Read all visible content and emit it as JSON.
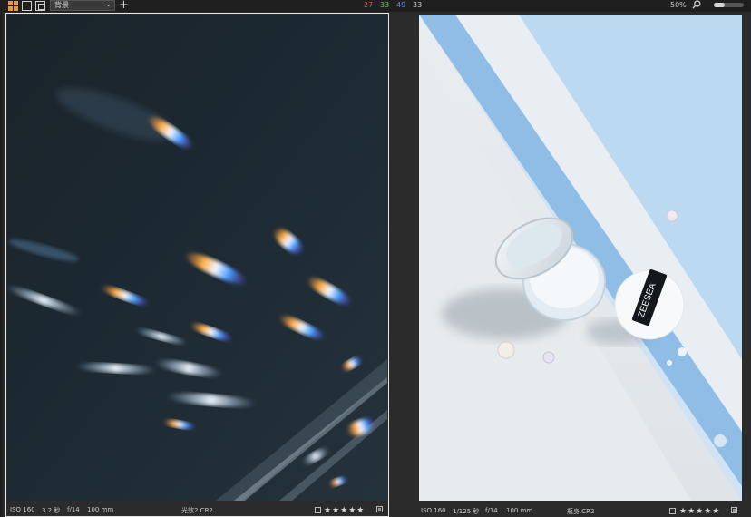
{
  "toolbar": {
    "variant_label": "背景",
    "counts": [
      {
        "value": "27",
        "color": "#e0505a"
      },
      {
        "value": "33",
        "color": "#6ccf5a"
      },
      {
        "value": "49",
        "color": "#6f86e6"
      },
      {
        "value": "33",
        "color": "#cfcfcf"
      }
    ],
    "zoom_label": "50%",
    "zoom_fraction": 0.35
  },
  "viewers": [
    {
      "iso": "ISO 160",
      "shutter": "3.2 秒",
      "aperture": "f/14",
      "focal": "100 mm",
      "filename": "光效2.CR2",
      "rating": "★★★★★",
      "selected": true
    },
    {
      "iso": "ISO 160",
      "shutter": "1/125 秒",
      "aperture": "f/14",
      "focal": "100 mm",
      "filename": "瓶身.CR2",
      "rating": "★★★★★",
      "selected": false
    }
  ],
  "product": {
    "puff_brand": "ZEESEA"
  },
  "colors": {
    "accent": "#f09a2a",
    "selection_border": "#e8e8e8"
  }
}
